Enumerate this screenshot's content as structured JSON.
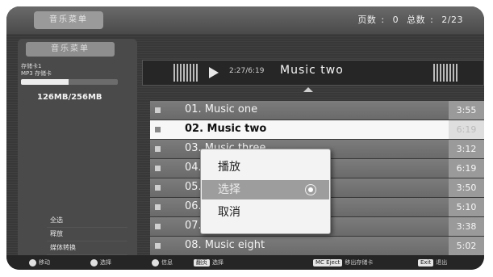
{
  "header": {
    "tab_label": "音乐菜单",
    "page_label": "页数",
    "page_value": "0",
    "total_label": "总数",
    "total_value": "2/23"
  },
  "sidebar": {
    "section_title": "音乐菜单",
    "device_line1": "存储卡1",
    "device_line2": "MP3 存储卡",
    "storage_fraction": 0.49,
    "capacity": "126MB/256MB",
    "menu": [
      {
        "label": "全选"
      },
      {
        "label": "释放"
      },
      {
        "label": "媒体转换"
      }
    ]
  },
  "player": {
    "time": "2:27/6:19",
    "now_playing": "Music two",
    "play_icon": "play-icon"
  },
  "tracks": [
    {
      "name": "01. Music one",
      "duration": "3:55",
      "selected": false
    },
    {
      "name": "02. Music two",
      "duration": "6:19",
      "selected": true
    },
    {
      "name": "03. Music three",
      "duration": "3:12",
      "selected": false
    },
    {
      "name": "04. Music four",
      "duration": "6:19",
      "selected": false
    },
    {
      "name": "05. Music five",
      "duration": "3:50",
      "selected": false
    },
    {
      "name": "06. Music six",
      "duration": "5:10",
      "selected": false
    },
    {
      "name": "07. Music seven",
      "duration": "3:38",
      "selected": false
    },
    {
      "name": "08. Music eight",
      "duration": "5:02",
      "selected": false
    }
  ],
  "popup": {
    "items": [
      {
        "label": "播放",
        "highlighted": false
      },
      {
        "label": "选择",
        "highlighted": true
      },
      {
        "label": "取消",
        "highlighted": false
      }
    ]
  },
  "bottombar": {
    "move_label": "移动",
    "select_label": "选择",
    "info_label": "信息",
    "page_key": "翻页",
    "page_label": "选择",
    "mc_key": "MC Eject",
    "mc_label": "移出存储卡",
    "exit_key": "Exit",
    "exit_label": "退出"
  },
  "colors": {
    "selected_row": "#f7f7f7",
    "row": "#747474",
    "popup_highlight": "#9d9d9d"
  }
}
